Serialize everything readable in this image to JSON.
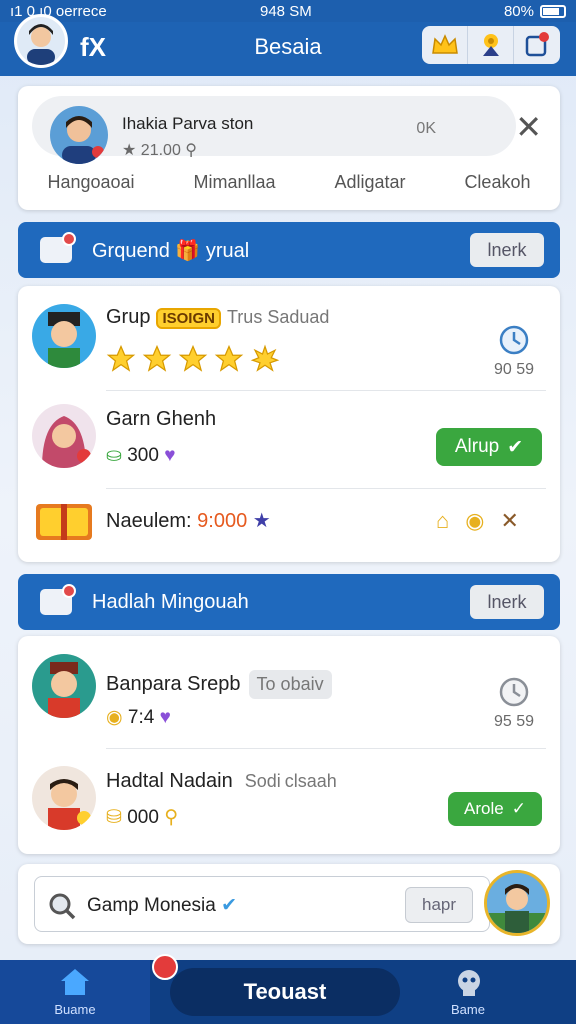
{
  "status_bar": {
    "carrier": "ı1 0 ı0 oerrece",
    "time": "948 SM",
    "battery": "80%"
  },
  "header": {
    "close_label": "fX",
    "title": "Besaia"
  },
  "profile": {
    "name": "Ihakia Parva ston",
    "score": "21.00",
    "ok": "0K",
    "tabs": [
      "Hangoaoai",
      "Mimanllaa",
      "Adligatar",
      "Cleakoh"
    ]
  },
  "section1": {
    "title": "Grquend 🎁 yrual",
    "button": "lnerk"
  },
  "list1": {
    "row1": {
      "name": "Grup",
      "badge": "ISOIGN",
      "subtitle": "Trus Saduad",
      "stars": 5,
      "time": "90 59"
    },
    "row2": {
      "name": "Garn Ghenh",
      "score": "300",
      "button": "Alrup"
    },
    "row3": {
      "label": "Naeulem:",
      "value": "9:000"
    }
  },
  "section2": {
    "title": "Hadlah Mingouah",
    "button": "lnerk"
  },
  "list2": {
    "row1": {
      "name": "Banpara Srepb",
      "tag": "To obaiv",
      "score": "7:4",
      "time": "95 59"
    },
    "row2": {
      "name": "Hadtal Nadain",
      "tag": "Sodi",
      "subtitle": "clsaah",
      "score": "000",
      "button": "Arole"
    }
  },
  "search": {
    "text": "Gamp Monesia",
    "button": "hapr"
  },
  "bottom_nav": {
    "home": "Buame",
    "center": "Teouast",
    "right": "Bame"
  },
  "colors": {
    "primary": "#1e63b4",
    "green": "#3aa73f",
    "star": "#ffcf2e"
  }
}
